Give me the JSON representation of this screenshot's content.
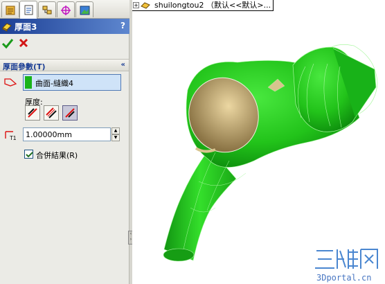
{
  "tabs": [
    {
      "name": "feature-manager",
      "icon": "feature-tree-icon"
    },
    {
      "name": "property-manager",
      "icon": "property-manager-icon"
    },
    {
      "name": "configuration-manager",
      "icon": "configuration-icon"
    },
    {
      "name": "dimxpert",
      "icon": "crosshair-icon"
    },
    {
      "name": "display-manager",
      "icon": "display-icon"
    }
  ],
  "panel": {
    "title": "厚面3",
    "help": "?",
    "ok_icon": "checkmark-icon",
    "cancel_icon": "x-icon"
  },
  "params": {
    "header": "厚面參數(T)",
    "collapse_glyph": "«",
    "selection": "曲面-縫織4",
    "selection_color": "#19b319",
    "thickness_label": "厚度:",
    "thickness_options": [
      "side1",
      "both",
      "side2"
    ],
    "thickness_value": "1.00000mm",
    "merge_label": "合併結果(R)",
    "merge_checked": true
  },
  "tree": {
    "node_label": "shuilongtou2 （默认<<默认>..."
  },
  "watermark": {
    "url": "3Dportal.cn"
  },
  "colors": {
    "title_bar": "#1c3f95",
    "model_green": "#22c31a",
    "model_inner": "#b7a06b"
  }
}
